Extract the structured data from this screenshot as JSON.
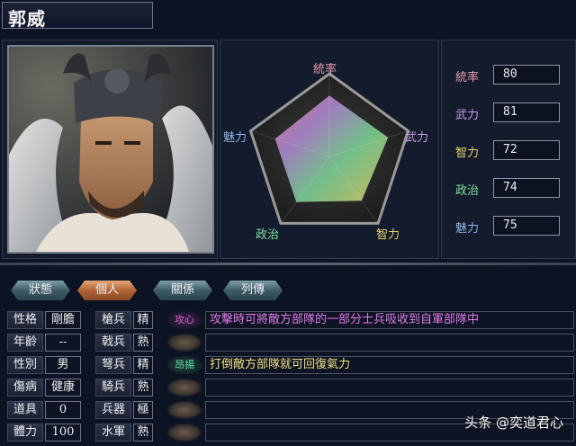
{
  "officer_name": "郭威",
  "radar": {
    "labels": {
      "top": "統率",
      "right": "武力",
      "bottom_right": "智力",
      "bottom_left": "政治",
      "left": "魅力"
    },
    "values": [
      80,
      81,
      72,
      74,
      75
    ],
    "max": 100
  },
  "stats": [
    {
      "label": "統率",
      "value": "80",
      "color": "#e39fb0"
    },
    {
      "label": "武力",
      "value": "81",
      "color": "#c79be3"
    },
    {
      "label": "智力",
      "value": "72",
      "color": "#e8d46a"
    },
    {
      "label": "政治",
      "value": "74",
      "color": "#7fe0a0"
    },
    {
      "label": "魅力",
      "value": "75",
      "color": "#8fb8e8"
    }
  ],
  "tabs": [
    "狀態",
    "個人",
    "關係",
    "列傳"
  ],
  "active_tab": "個人",
  "personal": [
    {
      "label": "性格",
      "value": "剛膽"
    },
    {
      "label": "年齡",
      "value": "--"
    },
    {
      "label": "性別",
      "value": "男"
    },
    {
      "label": "傷病",
      "value": "健康"
    },
    {
      "label": "道具",
      "value": "0"
    },
    {
      "label": "體力",
      "value": "100"
    }
  ],
  "aptitude": [
    {
      "label": "槍兵",
      "value": "精"
    },
    {
      "label": "戟兵",
      "value": "熟"
    },
    {
      "label": "弩兵",
      "value": "精"
    },
    {
      "label": "騎兵",
      "value": "熟"
    },
    {
      "label": "兵器",
      "value": "極"
    },
    {
      "label": "水軍",
      "value": "熟"
    }
  ],
  "skills": [
    {
      "tag": "攻心",
      "desc": "攻擊時可將敵方部隊的一部分士兵吸收到自軍部隊中",
      "tag_color": "#d85fd0",
      "desc_color": "#e07ae6"
    },
    {
      "tag": "",
      "desc": ""
    },
    {
      "tag": "昂揚",
      "desc": "打倒敵方部隊就可回復氣力",
      "tag_color": "#5fd8a8",
      "desc_color": "#f0e080"
    },
    {
      "tag": "",
      "desc": ""
    },
    {
      "tag": "",
      "desc": ""
    },
    {
      "tag": "",
      "desc": ""
    }
  ],
  "watermark": "头条 @奕道君心"
}
